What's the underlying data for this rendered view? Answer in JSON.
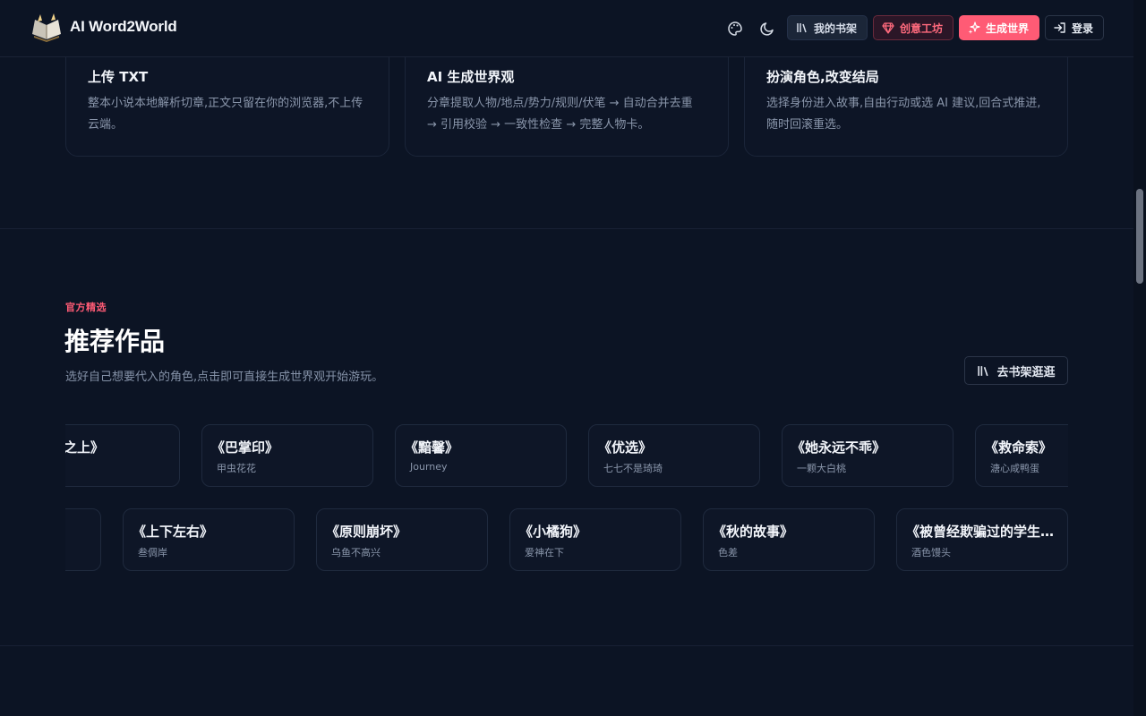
{
  "header": {
    "brand": "AI Word2World",
    "buttons": {
      "shelf": "我的书架",
      "craft": "创意工坊",
      "generate": "生成世界",
      "login": "登录"
    }
  },
  "features": [
    {
      "title": "上传 TXT",
      "desc": "整本小说本地解析切章,正文只留在你的浏览器,不上传云端。"
    },
    {
      "title": "AI 生成世界观",
      "desc": "分章提取人物/地点/势力/规则/伏笔 → 自动合并去重 → 引用校验 → 一致性检查 → 完整人物卡。"
    },
    {
      "title": "扮演角色,改变结局",
      "desc": "选择身份进入故事,自由行动或选 AI 建议,回合式推进,随时回滚重选。"
    }
  ],
  "recommend": {
    "eyebrow": "官方精选",
    "title": "推荐作品",
    "subtitle": "选好自己想要代入的角色,点击即可直接生成世界观开始游玩。",
    "browse_label": "去书架逛逛",
    "row1": [
      {
        "title": "《…之上》",
        "author": ""
      },
      {
        "title": "《巴掌印》",
        "author": "甲虫花花"
      },
      {
        "title": "《黯馨》",
        "author": "Journey"
      },
      {
        "title": "《优选》",
        "author": "七七不是琦琦"
      },
      {
        "title": "《她永远不乖》",
        "author": "一颗大白桃"
      },
      {
        "title": "《救命索》",
        "author": "溏心咸鸭蛋"
      }
    ],
    "row2": [
      {
        "title": "",
        "author": ""
      },
      {
        "title": "《上下左右》",
        "author": "叁倜岸"
      },
      {
        "title": "《原则崩坏》",
        "author": "乌鱼不高兴"
      },
      {
        "title": "《小橘狗》",
        "author": "爱神在下"
      },
      {
        "title": "《秋的故事》",
        "author": "色差"
      },
      {
        "title": "《被曾经欺骗过的学生反复爱上》",
        "author": "酒色馒头"
      }
    ]
  },
  "colors": {
    "accent": "#ff5b75",
    "background": "#0c1424",
    "card_border": "#1f2a3e"
  },
  "icons": [
    "logo-book-icon",
    "palette-icon",
    "moon-icon",
    "bookshelf-icon",
    "gem-icon",
    "sparkles-icon",
    "login-icon"
  ]
}
